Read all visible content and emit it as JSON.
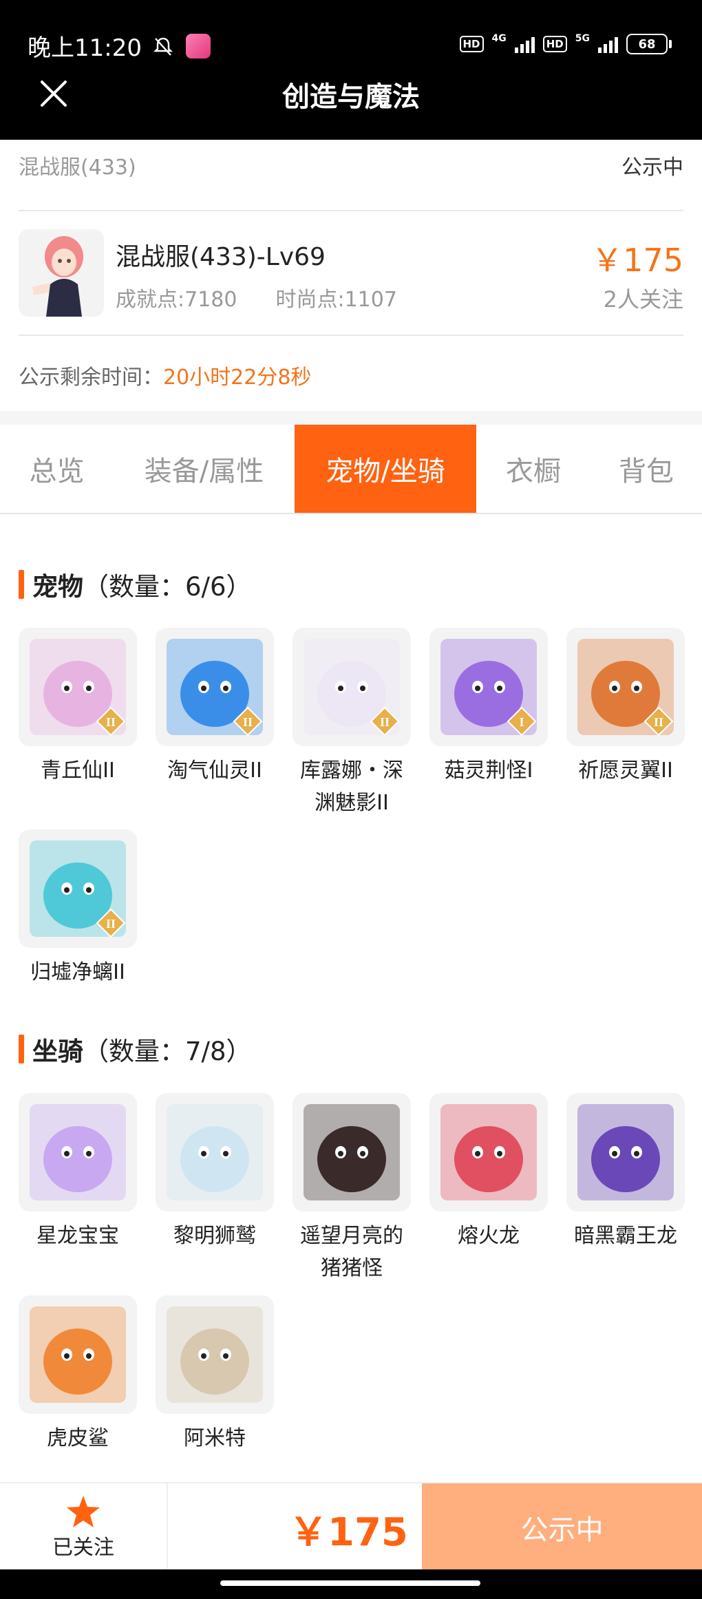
{
  "status_bar": {
    "time": "晚上11:20",
    "network1": "4G",
    "network2": "5G",
    "hd": "HD",
    "battery": "68"
  },
  "header": {
    "title": "创造与魔法"
  },
  "listing": {
    "server": "混战服(433)",
    "status": "公示中",
    "char_name": "混战服(433)-Lv69",
    "achievement": "成就点:7180",
    "fashion": "时尚点:1107",
    "price": "￥175",
    "followers": "2人关注",
    "remain_label": "公示剩余时间：",
    "remain_value": "20小时22分8秒"
  },
  "tabs": [
    {
      "label": "总览",
      "active": false
    },
    {
      "label": "装备/属性",
      "active": false
    },
    {
      "label": "宠物/坐骑",
      "active": true
    },
    {
      "label": "衣橱",
      "active": false
    },
    {
      "label": "背包",
      "active": false
    }
  ],
  "pets": {
    "title": "宠物",
    "count": "（数量：6/6）",
    "items": [
      {
        "name": "青丘仙II",
        "tier": "II",
        "color": "#e7b4e2",
        "icon": "fox-spirit-icon"
      },
      {
        "name": "淘气仙灵II",
        "tier": "II",
        "color": "#3a8ee8",
        "icon": "blue-puppy-icon"
      },
      {
        "name": "库露娜・深渊魅影II",
        "tier": "II",
        "color": "#ece6f5",
        "icon": "abyss-girl-icon"
      },
      {
        "name": "菇灵荆怪I",
        "tier": "I",
        "color": "#9a6ee0",
        "icon": "mushroom-sprite-icon"
      },
      {
        "name": "祈愿灵翼II",
        "tier": "II",
        "color": "#e07a3a",
        "icon": "phoenix-icon"
      },
      {
        "name": "归墟净螭II",
        "tier": "II",
        "color": "#4fc8d8",
        "icon": "water-dragon-icon"
      }
    ]
  },
  "mounts": {
    "title": "坐骑",
    "count": "（数量：7/8）",
    "items": [
      {
        "name": "星龙宝宝",
        "color": "#c8a8f0",
        "icon": "star-dragon-icon"
      },
      {
        "name": "黎明狮鹫",
        "color": "#cfe6f2",
        "icon": "griffin-icon"
      },
      {
        "name": "遥望月亮的猪猪怪",
        "color": "#3a2a2a",
        "icon": "pig-monster-icon"
      },
      {
        "name": "熔火龙",
        "color": "#e05060",
        "icon": "magma-dragon-icon"
      },
      {
        "name": "暗黑霸王龙",
        "color": "#6a48b8",
        "icon": "dark-trex-icon"
      },
      {
        "name": "虎皮鲨",
        "color": "#f08a3a",
        "icon": "tiger-shark-icon"
      },
      {
        "name": "阿米特",
        "color": "#d8c8b0",
        "icon": "crocodile-icon"
      }
    ]
  },
  "bottom": {
    "follow_label": "已关注",
    "price": "￥175",
    "status_button": "公示中"
  },
  "colors": {
    "accent": "#ff6211",
    "price": "#f5731b",
    "button_disabled": "#ffae7d"
  }
}
